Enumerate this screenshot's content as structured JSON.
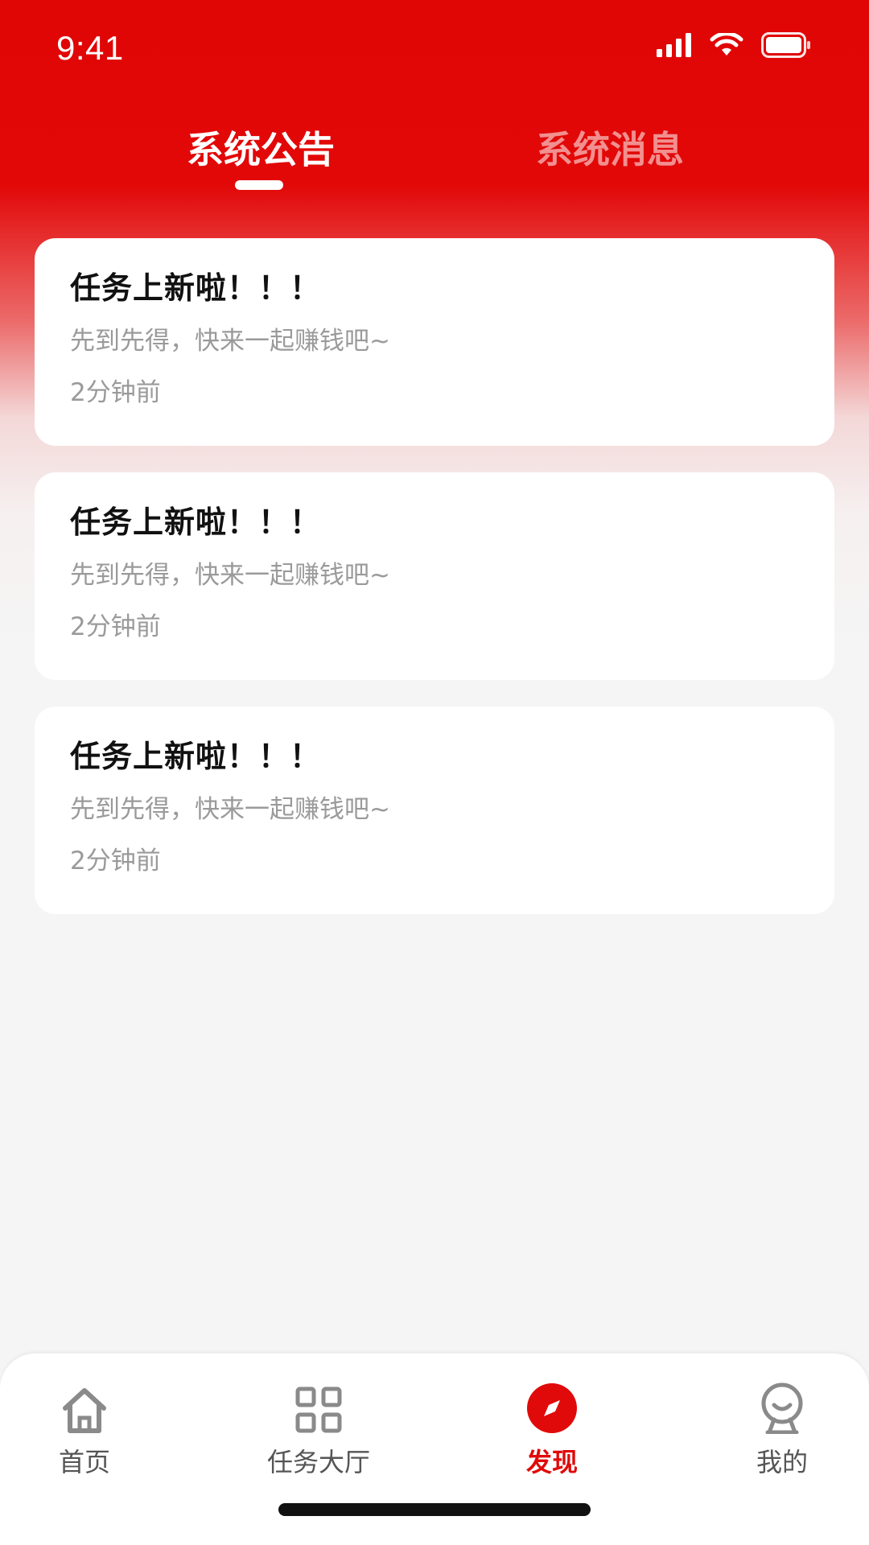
{
  "status_bar": {
    "time": "9:41"
  },
  "tabs": [
    {
      "label": "系统公告",
      "active": true
    },
    {
      "label": "系统消息",
      "active": false
    }
  ],
  "notices": [
    {
      "title": "任务上新啦！！！",
      "desc": "先到先得，快来一起赚钱吧~",
      "time": "2分钟前"
    },
    {
      "title": "任务上新啦！！！",
      "desc": "先到先得，快来一起赚钱吧~",
      "time": "2分钟前"
    },
    {
      "title": "任务上新啦！！！",
      "desc": "先到先得，快来一起赚钱吧~",
      "time": "2分钟前"
    }
  ],
  "bottom_nav": {
    "items": [
      {
        "label": "首页",
        "icon": "home-icon",
        "active": false
      },
      {
        "label": "任务大厅",
        "icon": "grid-icon",
        "active": false
      },
      {
        "label": "发现",
        "icon": "compass-icon",
        "active": true
      },
      {
        "label": "我的",
        "icon": "profile-icon",
        "active": false
      }
    ]
  },
  "colors": {
    "accent": "#e00a0a",
    "inactive": "#8a8a8a",
    "background": "#f5f5f5"
  }
}
